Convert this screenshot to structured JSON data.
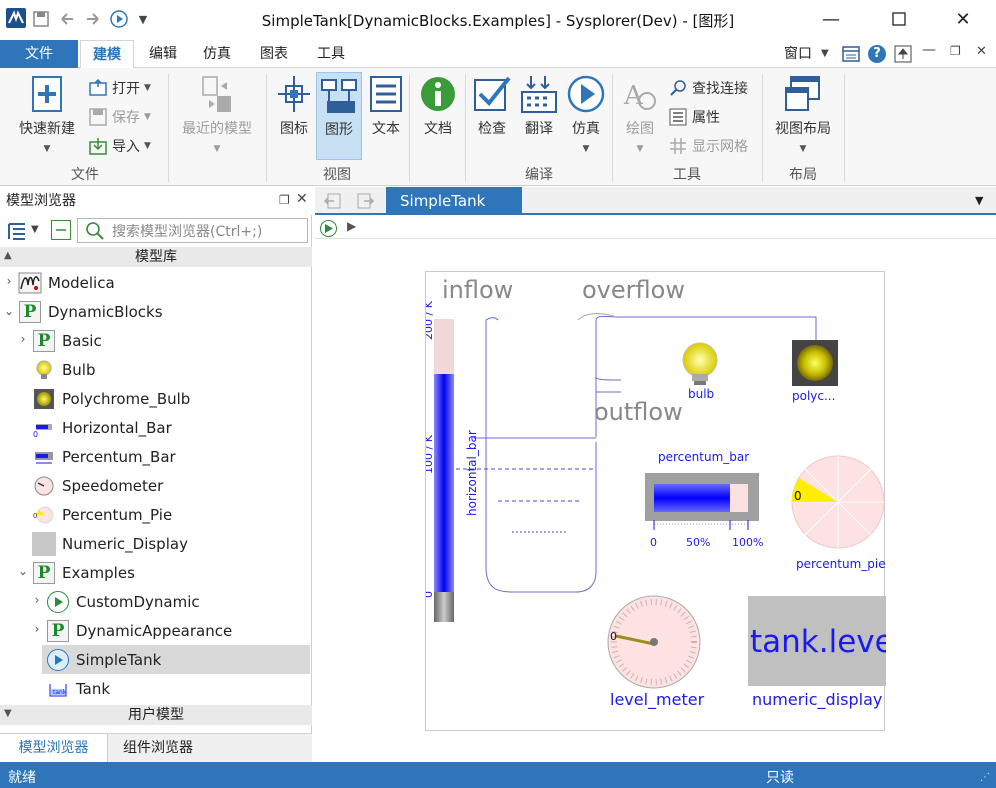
{
  "titlebar": {
    "title": "SimpleTank[DynamicBlocks.Examples] - Sysplorer(Dev) - [图形]"
  },
  "menu": {
    "tabs": [
      "文件",
      "建模",
      "编辑",
      "仿真",
      "图表",
      "工具"
    ],
    "right": {
      "window": "窗口"
    }
  },
  "ribbon": {
    "file_group": {
      "new": "快速新建",
      "open": "打开",
      "save": "保存",
      "import": "导入",
      "label": "文件"
    },
    "recent": "最近的模型",
    "view_group": {
      "icon": "图标",
      "diagram": "图形",
      "text": "文本",
      "label": "视图"
    },
    "doc": "文档",
    "compile_group": {
      "check": "检查",
      "translate": "翻译",
      "simulate": "仿真",
      "label": "编译"
    },
    "tools_group": {
      "draw": "绘图",
      "find_conn": "查找连接",
      "props": "属性",
      "grid": "显示网格",
      "label": "工具"
    },
    "layout_group": {
      "layout": "视图布局",
      "label": "布局"
    }
  },
  "browser": {
    "title": "模型浏览器",
    "search_placeholder": "搜索模型浏览器(Ctrl+;)",
    "section_lib": "模型库",
    "section_user": "用户模型",
    "items": [
      {
        "label": "Modelica"
      },
      {
        "label": "DynamicBlocks"
      },
      {
        "label": "Basic"
      },
      {
        "label": "Bulb"
      },
      {
        "label": "Polychrome_Bulb"
      },
      {
        "label": "Horizontal_Bar"
      },
      {
        "label": "Percentum_Bar"
      },
      {
        "label": "Speedometer"
      },
      {
        "label": "Percentum_Pie"
      },
      {
        "label": "Numeric_Display"
      },
      {
        "label": "Examples"
      },
      {
        "label": "CustomDynamic"
      },
      {
        "label": "DynamicAppearance"
      },
      {
        "label": "SimpleTank"
      },
      {
        "label": "Tank"
      }
    ],
    "bottom_tabs": [
      "模型浏览器",
      "组件浏览器"
    ]
  },
  "doc": {
    "tab": "SimpleTank",
    "diagram": {
      "inflow": "inflow",
      "overflow": "overflow",
      "outflow": "outflow",
      "axis_top": "200 / K",
      "axis_mid": "100 / K",
      "axis_zero": "0",
      "horizontal_bar": "horizontal_bar",
      "bulb": "bulb",
      "polyc": "polyc...",
      "percentum_bar": "percentum_bar",
      "pbar_ticks": [
        "0",
        "50%",
        "100%"
      ],
      "percentum_pie": "percentum_pie",
      "pie_zero": "0",
      "meter_zero": "0",
      "level_meter": "level_meter",
      "numeric_value": "tank.level",
      "numeric_display": "numeric_display"
    }
  },
  "status": {
    "left": "就绪",
    "right": "只读"
  },
  "colors": {
    "accent": "#2e76b9",
    "active_ribbon": "#c7e0f4",
    "diagram_blue": "#1a1aee"
  }
}
